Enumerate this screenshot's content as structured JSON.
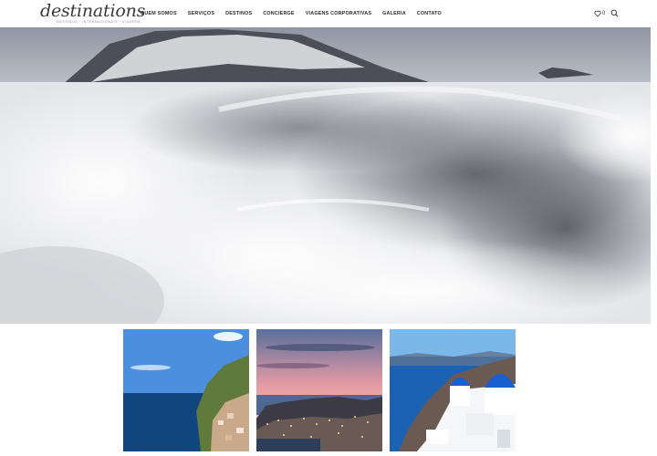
{
  "brand": {
    "logo_text": "destinations",
    "tagline": "DESTINOS · INTERNACIONAIS · VIAGENS"
  },
  "nav": {
    "items": [
      {
        "label": "QUEM SOMOS"
      },
      {
        "label": "SERVIÇOS"
      },
      {
        "label": "DESTINOS"
      },
      {
        "label": "CONCIERGE"
      },
      {
        "label": "VIAGENS CORPORATIVAS"
      },
      {
        "label": "GALERIA"
      },
      {
        "label": "CONTATO"
      }
    ]
  },
  "header_icons": {
    "wishlist_icon": "heart-icon",
    "wishlist_count": "0",
    "search_icon": "search-icon"
  },
  "hero": {
    "image": "snowy-mountain-clouds-aerial"
  },
  "gallery": {
    "cards": [
      {
        "image": "amalfi-coast-cliffs"
      },
      {
        "image": "dubrovnik-old-town-dusk"
      },
      {
        "image": "santorini-blue-domes"
      }
    ]
  },
  "colors": {
    "accent": "#2b2b2b",
    "background": "#ffffff"
  }
}
